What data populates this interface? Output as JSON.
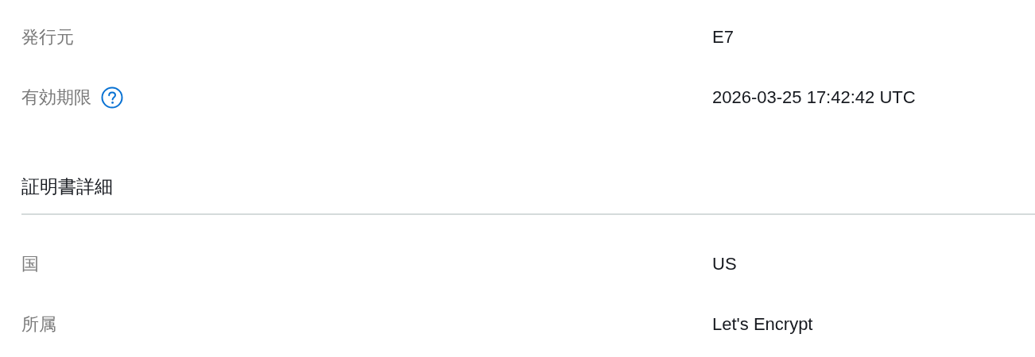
{
  "rows": [
    {
      "label": "発行元",
      "value": "E7",
      "help": false
    },
    {
      "label": "有効期限",
      "value": "2026-03-25 17:42:42 UTC",
      "help": true
    }
  ],
  "sections": [
    {
      "heading": "証明書詳細",
      "rows": [
        {
          "label": "国",
          "value": "US",
          "help": false
        },
        {
          "label": "所属",
          "value": "Let's Encrypt",
          "help": false
        }
      ]
    }
  ]
}
